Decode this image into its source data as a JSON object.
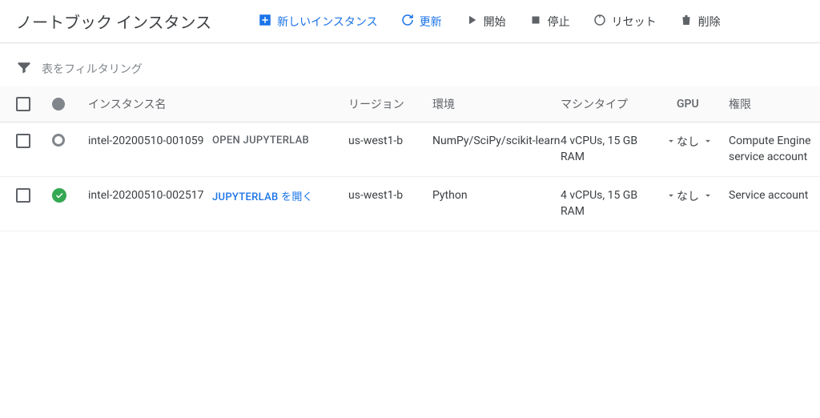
{
  "header": {
    "title": "ノートブック インスタンス",
    "actions": {
      "new": "新しいインスタンス",
      "refresh": "更新",
      "start": "開始",
      "stop": "停止",
      "reset": "リセット",
      "delete": "削除"
    }
  },
  "filter": {
    "placeholder": "表をフィルタリング"
  },
  "columns": {
    "name": "インスタンス名",
    "region": "リージョン",
    "env": "環境",
    "machine": "マシンタイプ",
    "gpu": "GPU",
    "perm": "権限"
  },
  "rows": [
    {
      "status": "provisioning",
      "name": "intel-20200510-001059",
      "action_label": "OPEN JUPYTERLAB",
      "action_active": false,
      "region": "us-west1-b",
      "env": "NumPy/SciPy/scikit-learn",
      "machine": "4 vCPUs, 15 GB RAM",
      "gpu": "なし",
      "perm": "Compute Engine service account"
    },
    {
      "status": "running",
      "name": "intel-20200510-002517",
      "action_label": "JUPYTERLAB を開く",
      "action_active": true,
      "region": "us-west1-b",
      "env": "Python",
      "machine": "4 vCPUs, 15 GB RAM",
      "gpu": "なし",
      "perm": "Service account"
    }
  ]
}
